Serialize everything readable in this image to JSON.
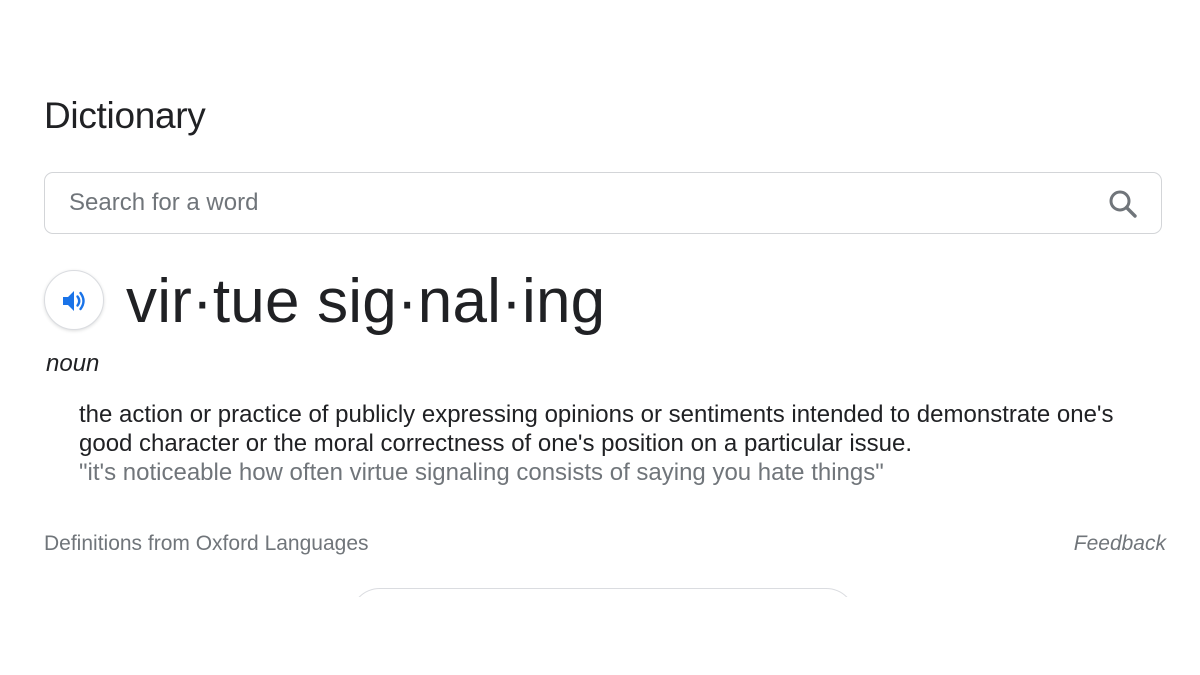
{
  "dictionary": {
    "title": "Dictionary",
    "search": {
      "placeholder": "Search for a word",
      "value": ""
    },
    "entry": {
      "headword": "vir·tue sig·nal·ing",
      "part_of_speech": "noun",
      "definition": "the action or practice of publicly expressing opinions or sentiments intended to demonstrate one's good character or the moral correctness of one's position on a particular issue.",
      "example": "\"it's noticeable how often virtue signaling consists of saying you hate things\""
    },
    "footer": {
      "source": "Definitions from Oxford Languages",
      "feedback": "Feedback"
    }
  },
  "icons": {
    "search": "search-icon",
    "speaker": "speaker-icon"
  },
  "colors": {
    "text_primary": "#202124",
    "text_secondary": "#70757a",
    "accent_blue": "#1a73e8",
    "border": "#dadce0"
  }
}
